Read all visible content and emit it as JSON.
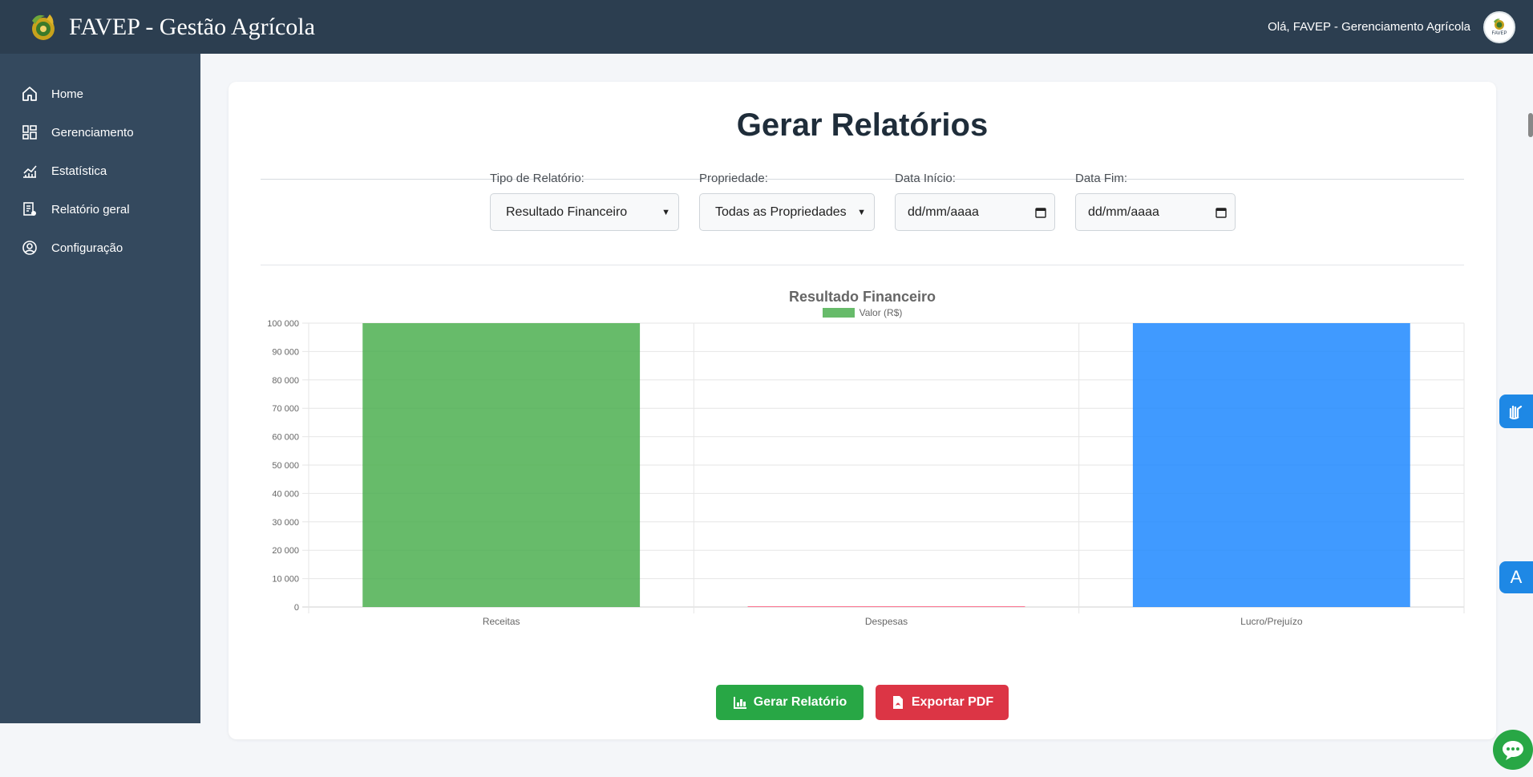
{
  "header": {
    "brand_title": "FAVEP - Gestão Agrícola",
    "greeting": "Olá, FAVEP - Gerenciamento Agrícola",
    "avatar_text": "FAVEP"
  },
  "sidebar": {
    "items": [
      {
        "label": "Home",
        "icon": "home-icon"
      },
      {
        "label": "Gerenciamento",
        "icon": "dashboard-grid-icon"
      },
      {
        "label": "Estatística",
        "icon": "chart-line-icon"
      },
      {
        "label": "Relatório geral",
        "icon": "report-icon"
      },
      {
        "label": "Configuração",
        "icon": "user-circle-icon"
      }
    ]
  },
  "main": {
    "title": "Gerar Relatórios",
    "filters": {
      "tipo_label": "Tipo de Relatório:",
      "tipo_value": "Resultado Financeiro",
      "propriedade_label": "Propriedade:",
      "propriedade_value": "Todas as Propriedades",
      "inicio_label": "Data Início:",
      "inicio_value": "dd/mm/aaaa",
      "fim_label": "Data Fim:",
      "fim_value": "dd/mm/aaaa"
    },
    "buttons": {
      "gerar": "Gerar Relatório",
      "exportar": "Exportar PDF"
    }
  },
  "widgets": {
    "font_button": "A"
  },
  "colors": {
    "header_bg": "#2c3e50",
    "sidebar_bg": "#34495e",
    "green": "#28a745",
    "red": "#dc3545",
    "bar_green": "#4caf50",
    "bar_blue": "#1e88ff"
  },
  "chart_data": {
    "type": "bar",
    "title": "Resultado Financeiro",
    "categories": [
      "Receitas",
      "Despesas",
      "Lucro/Prejuízo"
    ],
    "series": [
      {
        "name": "Valor (R$)",
        "values": [
          100000,
          0,
          100000
        ],
        "colors": [
          "#4caf50",
          "#ff6384",
          "#1e88ff"
        ]
      }
    ],
    "ylim": [
      0,
      100000
    ],
    "yticks": [
      "0",
      "10 000",
      "20 000",
      "30 000",
      "40 000",
      "50 000",
      "60 000",
      "70 000",
      "80 000",
      "90 000",
      "100 000"
    ],
    "grid": true,
    "legend": "top-center"
  }
}
